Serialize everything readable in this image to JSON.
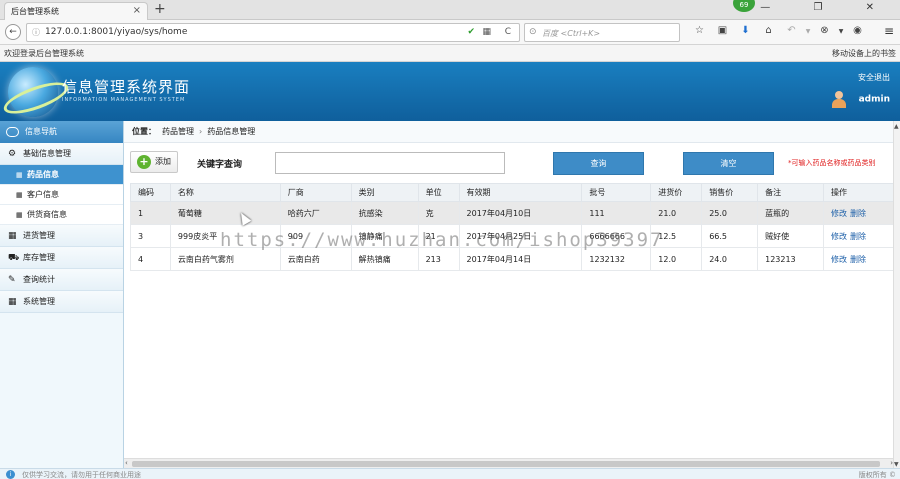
{
  "browser": {
    "tab_title": "后台管理系统",
    "tab_close": "×",
    "new_tab": "+",
    "ext_badge": "69",
    "window_controls": "— ❐ ✕",
    "back": "←",
    "info": "ⓘ",
    "url": "127.0.0.1:8001/yiyao/sys/home",
    "shield": "✔",
    "qr": "▦",
    "reload": "C",
    "search_icon": "⊙",
    "search_placeholder": "百度 <Ctrl+K>",
    "toolbar_icons": [
      "☆",
      "▣",
      "⬇",
      "⌂",
      "↶",
      "▼",
      "⊗",
      "▼",
      "◉"
    ],
    "menu": "≡",
    "bookmark": "欢迎登录后台管理系统",
    "bookmark_right": "移动设备上的书签"
  },
  "header": {
    "title": "信息管理系统界面",
    "subtitle": "INFORMATION MANAGEMENT SYSTEM",
    "logout": "安全退出",
    "user": "admin"
  },
  "sidebar": {
    "head": "信息导航",
    "groups": [
      {
        "icon": "⚙",
        "label": "基础信息管理"
      },
      {
        "icon": "▦",
        "label": "进货管理"
      },
      {
        "icon": "⛟",
        "label": "库存管理"
      },
      {
        "icon": "✎",
        "label": "查询统计"
      },
      {
        "icon": "▦",
        "label": "系统管理"
      }
    ],
    "subitems": [
      {
        "icon": "▦",
        "label": "药品信息"
      },
      {
        "icon": "▦",
        "label": "客户信息"
      },
      {
        "icon": "▦",
        "label": "供货商信息"
      }
    ]
  },
  "breadcrumb": {
    "label": "位置：",
    "items": [
      "药品管理",
      "药品信息管理"
    ],
    "sep": "›"
  },
  "toolbar": {
    "add": "添加",
    "add_icon": "+",
    "keyword_label": "关键字查询",
    "keyword_value": "",
    "query": "查询",
    "clear": "清空",
    "hint": "*可输入药品名称或药品类别"
  },
  "table": {
    "headers": [
      "编码",
      "名称",
      "厂商",
      "类别",
      "单位",
      "有效期",
      "批号",
      "进货价",
      "销售价",
      "备注",
      "操作"
    ],
    "rows": [
      [
        "1",
        "葡萄糖",
        "哈药六厂",
        "抗感染",
        "克",
        "2017年04月10日",
        "111",
        "21.0",
        "25.0",
        "蓝瓶的"
      ],
      [
        "3",
        "999皮炎平",
        "909",
        "镇静痛",
        "21",
        "2017年04月25日",
        "6666666",
        "12.5",
        "66.5",
        "贼好使"
      ],
      [
        "4",
        "云南白药气雾剂",
        "云南白药",
        "解热镇痛",
        "213",
        "2017年04月14日",
        "1232132",
        "12.0",
        "24.0",
        "123213"
      ]
    ],
    "op_edit": "修改",
    "op_delete": "删除"
  },
  "watermark": "https://www.huzhan.com/ishop39397",
  "scroll": {
    "left": "‹",
    "right": "›",
    "up": "▲",
    "down": "▼"
  },
  "footer": {
    "icon": "i",
    "text": "仅供学习交流，请勿用于任何商业用途",
    "right": "版权所有 ©"
  }
}
